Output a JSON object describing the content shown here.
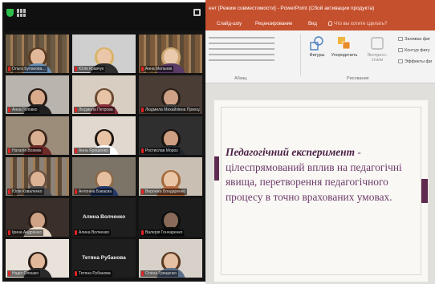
{
  "zoom": {
    "tiles": [
      {
        "name": "Ольга Буланова…",
        "type": "video",
        "active": true
      },
      {
        "name": "Юлія Кравчук",
        "type": "video"
      },
      {
        "name": "Анна Мельник",
        "type": "video"
      },
      {
        "name": "Анна Головко",
        "type": "video"
      },
      {
        "name": "Людмила Петрова",
        "type": "video"
      },
      {
        "name": "Людмила Михайлівна Приходько",
        "type": "video"
      },
      {
        "name": "Наталія Вознюк",
        "type": "video"
      },
      {
        "name": "Анна Ярошенко",
        "type": "video"
      },
      {
        "name": "Ростислав Мороз",
        "type": "video"
      },
      {
        "name": "Юлія Коваленко",
        "type": "video"
      },
      {
        "name": "Антоніна Бакаєва",
        "type": "video"
      },
      {
        "name": "Вероніка Бондаренко",
        "type": "video"
      },
      {
        "name": "Ірина Андрієнко",
        "type": "video"
      },
      {
        "name": "Алина Волченко",
        "type": "name",
        "big_name": "Алина Волченко"
      },
      {
        "name": "Валерія Гончаренко",
        "type": "video"
      },
      {
        "name": "Надія Олешко",
        "type": "video"
      },
      {
        "name": "Тетяна Рубанова",
        "type": "name",
        "big_name": "Тетяна Рубанова"
      },
      {
        "name": "Олена Грищенко",
        "type": "video"
      }
    ]
  },
  "ppt": {
    "title": "ент [Режим совместимости] - PowerPoint (Сбой активации продукта)",
    "tabs": {
      "slideshow": "Слайд-шоу",
      "review": "Рецензирование",
      "view": "Вид",
      "tell_me": "Что вы хотите сделать?"
    },
    "ribbon": {
      "paragraph_label": "Абзац",
      "drawing_label": "Рисование",
      "shapes": "Фигуры",
      "arrange": "Упорядочить",
      "quick_styles_1": "Экспресс-",
      "quick_styles_2": "стили",
      "shape_fill": "Заливка фиг",
      "shape_outline": "Контур фигу",
      "shape_effects": "Эффекты фи"
    },
    "slide": {
      "term": "Педагогічний експеримент",
      "rest": " - цілеспрямований вплив на педагогічні явища, перетворення педагогічного процесу в точно врахованих умовах."
    }
  },
  "colors": {
    "ppt_accent": "#c5502e",
    "slide_text": "#6e3b6a",
    "slide_term": "#4c2145",
    "zoom_active_border": "#e9d33a"
  }
}
